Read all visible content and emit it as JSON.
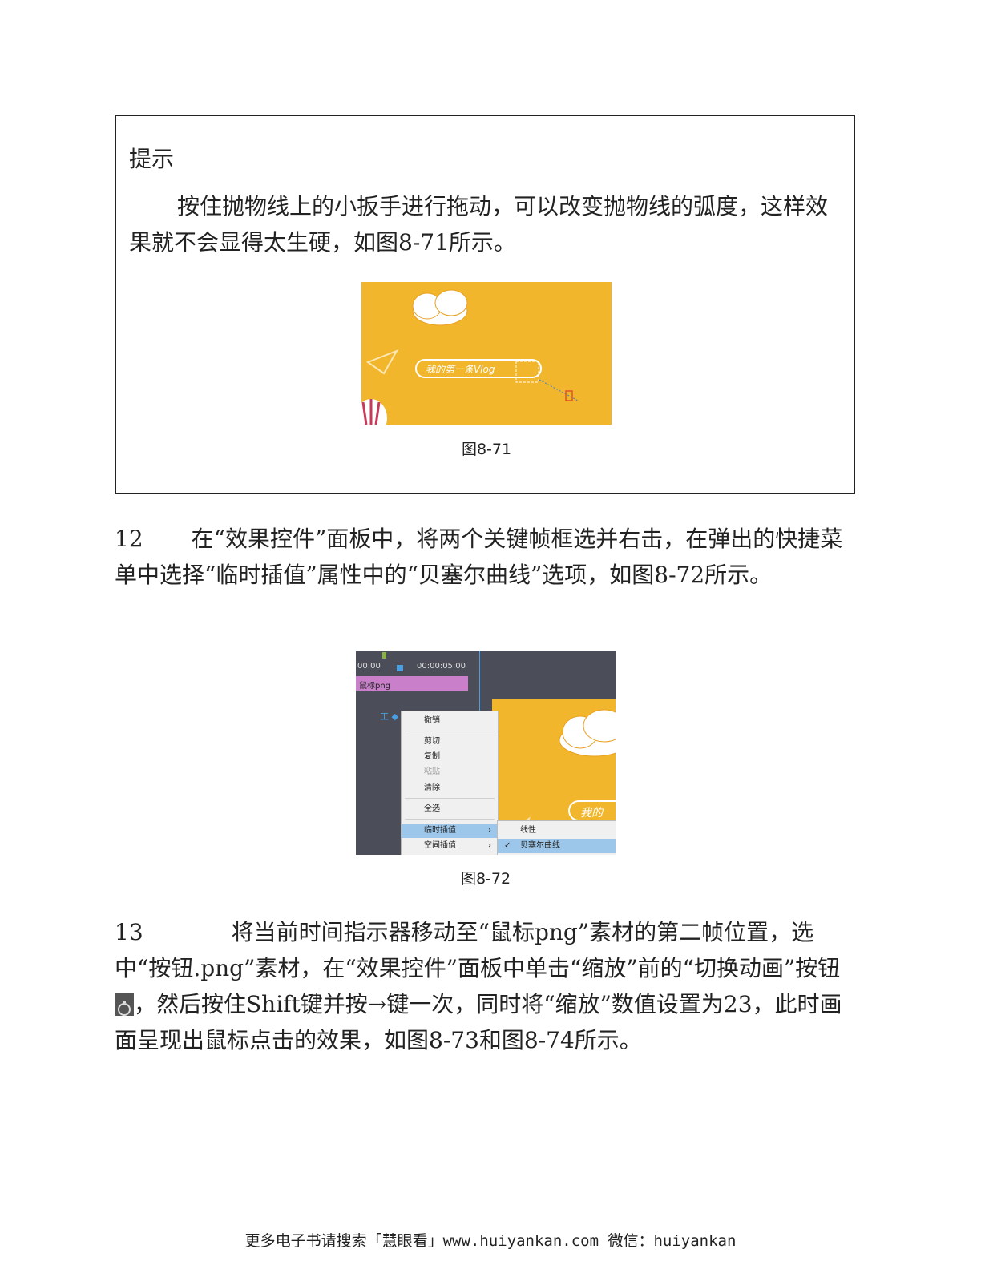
{
  "tip": {
    "title": "提示",
    "text": "按住抛物线上的小扳手进行拖动，可以改变抛物线的弧度，这样效果就不会显得太生硬，如图8-71所示。"
  },
  "figure1": {
    "caption": "图8-71",
    "banner_text": "我的第一条Vlog"
  },
  "step12": {
    "number": "12",
    "text": "在“效果控件”面板中，将两个关键帧框选并右击，在弹出的快捷菜单中选择“临时插值”属性中的“贝塞尔曲线”选项，如图8-72所示。"
  },
  "figure2": {
    "caption": "图8-72",
    "timecode_start": "00:00",
    "timecode_end": "00:00:05:00",
    "clip_name": "鼠标png",
    "menu_items": [
      "撤销",
      "剪切",
      "复制",
      "粘贴",
      "清除",
      "全选",
      "临时插值",
      "空间插值"
    ],
    "submenu_items": [
      "线性",
      "贝塞尔曲线"
    ],
    "banner_partial": "我的"
  },
  "step13": {
    "number": "13",
    "text_before_icon": "将当前时间指示器移动至“鼠标png”素材的第二帧位置，选中“按钮.png”素材，在“效果控件”面板中单击“缩放”前的“切换动画”按钮",
    "text_after_icon": "，然后按住Shift键并按→键一次，同时将“缩放”数值设置为23，此时画面呈现出鼠标点击的效果，如图8-73和图8-74所示。"
  },
  "footer": {
    "text": "更多电子书请搜索「慧眼看」www.huiyankan.com  微信：huiyankan"
  },
  "colors": {
    "yellow_bg": "#f2b62c",
    "panel_dark": "#4b4e58",
    "clip_purple": "#c97fc9",
    "menu_highlight": "#9cc7ea"
  }
}
